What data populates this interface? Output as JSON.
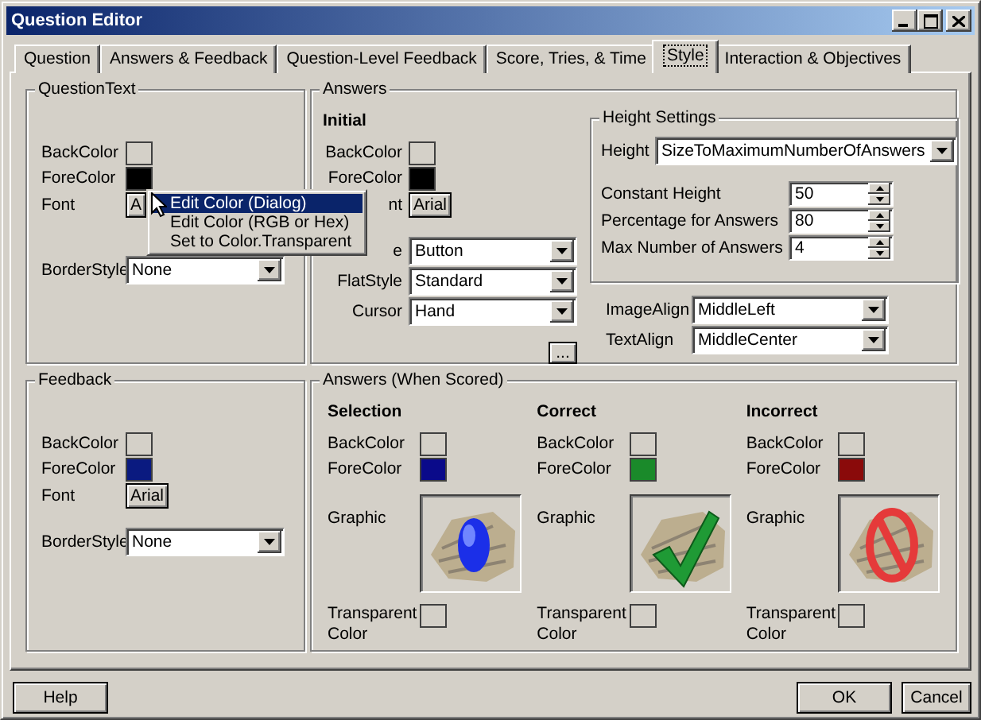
{
  "window": {
    "title": "Question Editor"
  },
  "tabs": [
    {
      "label": "Question",
      "selected": false
    },
    {
      "label": "Answers & Feedback",
      "selected": false
    },
    {
      "label": "Question-Level Feedback",
      "selected": false
    },
    {
      "label": "Score, Tries, & Time",
      "selected": false
    },
    {
      "label": "Style",
      "selected": true
    },
    {
      "label": "Interaction & Objectives",
      "selected": false
    }
  ],
  "question_text": {
    "title": "QuestionText",
    "properties": [
      {
        "kind": "color",
        "label": "BackColor",
        "color": "#d4d0c8"
      },
      {
        "kind": "color",
        "label": "ForeColor",
        "color": "#000000"
      },
      {
        "kind": "font",
        "label": "Font",
        "value": "A"
      },
      {
        "kind": "combo",
        "label": "BorderStyle",
        "value": "None"
      }
    ]
  },
  "context_menu": {
    "items": [
      {
        "label": "Edit Color (Dialog)",
        "selected": true
      },
      {
        "label": "Edit Color (RGB or Hex)",
        "selected": false
      },
      {
        "label": "Set to Color.Transparent",
        "selected": false
      }
    ]
  },
  "answers": {
    "title": "Answers",
    "initial": {
      "heading": "Initial",
      "properties": [
        {
          "kind": "color",
          "label": "BackColor",
          "color": "#d4d0c8"
        },
        {
          "kind": "color",
          "label": "ForeColor",
          "color": "#000000"
        },
        {
          "kind": "font",
          "label": "nt",
          "value": "Arial"
        },
        {
          "kind": "combo",
          "label": "e",
          "value": "Button"
        },
        {
          "kind": "combo",
          "label": "FlatStyle",
          "value": "Standard"
        },
        {
          "kind": "combo",
          "label": "Cursor",
          "value": "Hand"
        }
      ],
      "more_button": "..."
    },
    "height_settings": {
      "title": "Height Settings",
      "properties": [
        {
          "kind": "combo",
          "label": "Height",
          "value": "SizeToMaximumNumberOfAnswers"
        },
        {
          "kind": "spin",
          "label": "Constant Height",
          "value": "50"
        },
        {
          "kind": "spin",
          "label": "Percentage for Answers",
          "value": "80"
        },
        {
          "kind": "spin",
          "label": "Max Number of Answers",
          "value": "4"
        }
      ]
    },
    "alignment": [
      {
        "kind": "combo",
        "label": "ImageAlign",
        "value": "MiddleLeft"
      },
      {
        "kind": "combo",
        "label": "TextAlign",
        "value": "MiddleCenter"
      }
    ]
  },
  "feedback": {
    "title": "Feedback",
    "properties": [
      {
        "kind": "color",
        "label": "BackColor",
        "color": "#d4d0c8"
      },
      {
        "kind": "color",
        "label": "ForeColor",
        "color": "#0a1a80"
      },
      {
        "kind": "font",
        "label": "Font",
        "value": "Arial"
      },
      {
        "kind": "combo",
        "label": "BorderStyle",
        "value": "None"
      }
    ]
  },
  "answers_when_scored": {
    "title": "Answers (When Scored)",
    "columns": [
      {
        "heading": "Selection",
        "properties": [
          {
            "kind": "color",
            "label": "BackColor",
            "color": "#d4d0c8"
          },
          {
            "kind": "color",
            "label": "ForeColor",
            "color": "#0a0a8a"
          },
          {
            "kind": "graphic",
            "label": "Graphic"
          },
          {
            "kind": "transparent",
            "label": "Transparent Color",
            "color": "#d4d0c8"
          }
        ]
      },
      {
        "heading": "Correct",
        "properties": [
          {
            "kind": "color",
            "label": "BackColor",
            "color": "#d4d0c8"
          },
          {
            "kind": "color",
            "label": "ForeColor",
            "color": "#1a8a2a"
          },
          {
            "kind": "graphic",
            "label": "Graphic"
          },
          {
            "kind": "transparent",
            "label": "Transparent Color",
            "color": "#d4d0c8"
          }
        ]
      },
      {
        "heading": "Incorrect",
        "properties": [
          {
            "kind": "color",
            "label": "BackColor",
            "color": "#d4d0c8"
          },
          {
            "kind": "color",
            "label": "ForeColor",
            "color": "#8a0a0a"
          },
          {
            "kind": "graphic",
            "label": "Graphic"
          },
          {
            "kind": "transparent",
            "label": "Transparent Color",
            "color": "#d4d0c8"
          }
        ]
      }
    ]
  },
  "buttons": {
    "help": "Help",
    "ok": "OK",
    "cancel": "Cancel"
  }
}
